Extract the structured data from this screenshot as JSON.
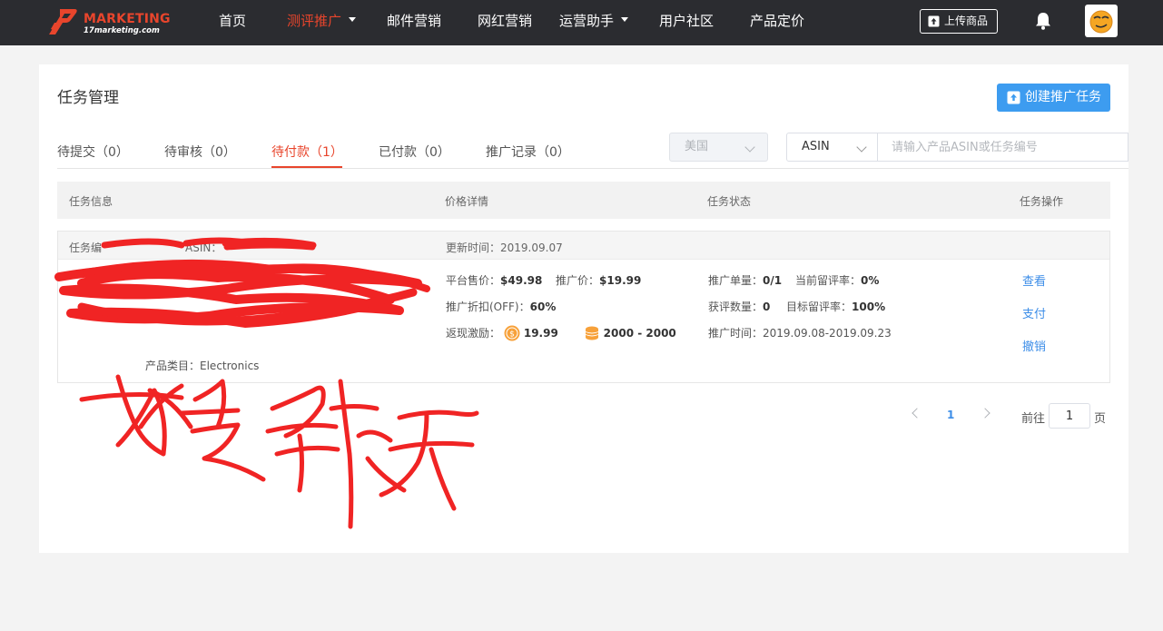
{
  "colors": {
    "topbar": "#2b2c30",
    "accent": "#e8452c",
    "primary": "#3d9cf0",
    "link": "#3d8ee8",
    "scribble": "#f02424"
  },
  "brand": {
    "name": "MARKETING",
    "sub": "17marketing.com",
    "icon": "brand-logo-icon"
  },
  "nav": {
    "items": [
      {
        "label": "首页",
        "dropdown": false
      },
      {
        "label": "测评推广",
        "dropdown": true,
        "active": true
      },
      {
        "label": "邮件营销",
        "dropdown": false
      },
      {
        "label": "网红营销",
        "dropdown": false
      },
      {
        "label": "运营助手",
        "dropdown": true
      },
      {
        "label": "用户社区",
        "dropdown": false
      },
      {
        "label": "产品定价",
        "dropdown": false
      }
    ],
    "upload_label": "上传商品",
    "icons": [
      "upload-icon",
      "bell-icon",
      "avatar-smiley-icon"
    ]
  },
  "page": {
    "title": "任务管理",
    "create_label": "创建推广任务",
    "tabs": [
      {
        "label": "待提交（0）"
      },
      {
        "label": "待审核（0）"
      },
      {
        "label": "待付款（1）",
        "active": true
      },
      {
        "label": "已付款（0）"
      },
      {
        "label": "推广记录（0）"
      }
    ],
    "filter": {
      "country": "美国",
      "search_type": "ASIN",
      "search_placeholder": "请输入产品ASIN或任务编号"
    },
    "columns": [
      "任务信息",
      "价格详情",
      "任务状态",
      "任务操作"
    ]
  },
  "order": {
    "task_id_label": "任务编",
    "asin_label": "ASIN：",
    "updated": "更新时间：2019.09.07",
    "category_label": "产品类目：",
    "category_value": "Electronics",
    "price": {
      "platform_label": "平台售价：",
      "platform_value": "$49.98",
      "promo_label": "推广价：",
      "promo_value": "$19.99",
      "discount_label": "推广折扣(OFF)：",
      "discount_value": "60%"
    },
    "cashback": {
      "label": "返现激励：",
      "coin_value": "19.99",
      "points_value": "2000 - 2000"
    },
    "status": {
      "units_label": "推广单量：",
      "units_value": "0/1",
      "retention_label": "当前留评率：",
      "retention_value": "0%",
      "reviews_label": "获评数量：",
      "reviews_value": "0",
      "target_label": "目标留评率：",
      "target_value": "100%",
      "period_label": "推广时间：",
      "period_value": "2019.09.08-2019.09.23"
    },
    "actions": [
      "查看",
      "支付",
      "撤销"
    ]
  },
  "pagination": {
    "current": "1",
    "goto_prefix": "前往",
    "goto_value": "1",
    "goto_suffix": "页"
  }
}
